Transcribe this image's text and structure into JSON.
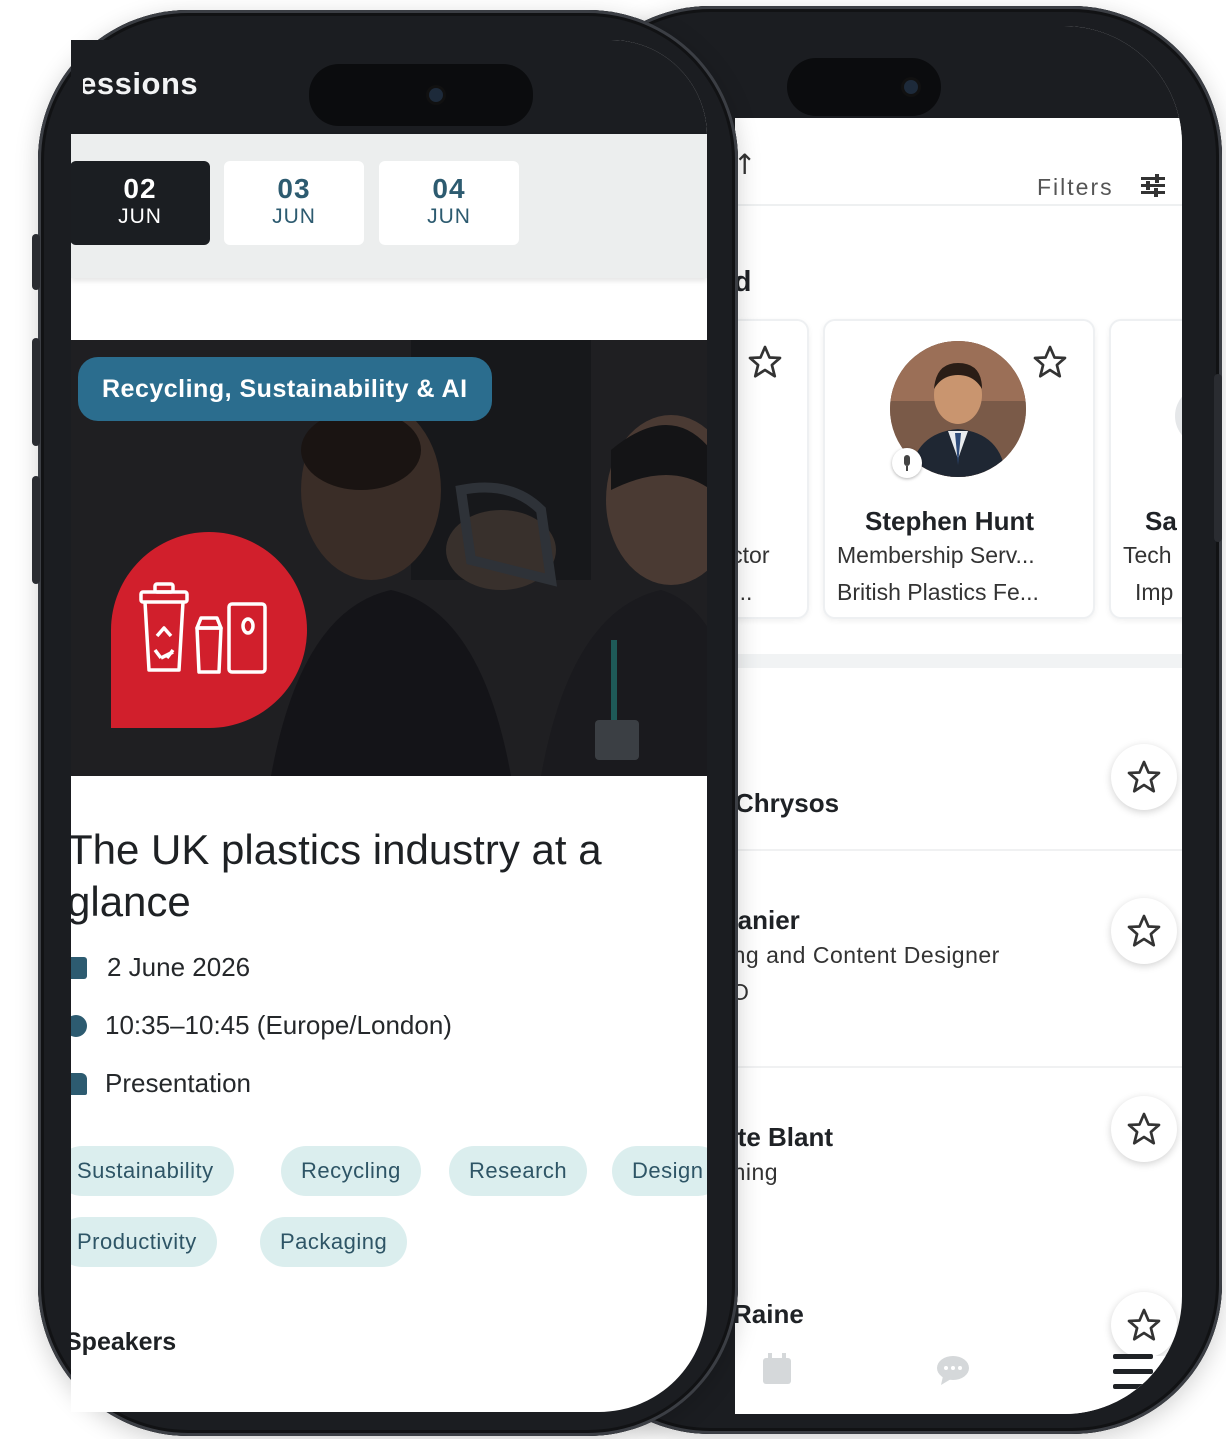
{
  "front": {
    "header_title": "Sessions",
    "dates": [
      {
        "day": "02",
        "month": "JUN",
        "active": true
      },
      {
        "day": "03",
        "month": "JUN",
        "active": false
      },
      {
        "day": "04",
        "month": "JUN",
        "active": false
      }
    ],
    "hero_tag": "Recycling, Sustainability & AI",
    "session_title": "The UK plastics industry at a glance",
    "date_text": "2 June 2026",
    "time_text": "10:35–10:45 (Europe/London)",
    "format_text": "Presentation",
    "tags": [
      "Sustainability",
      "Recycling",
      "Research",
      "Design",
      "Productivity",
      "Packaging"
    ],
    "speakers_heading": "Speakers"
  },
  "back": {
    "filters_label": "Filters",
    "featured_heading": "Featured",
    "featured_cards": [
      {
        "name": "",
        "role": "Director",
        "org": "Technol..."
      },
      {
        "name": "Stephen Hunt",
        "role": "Membership Serv...",
        "org": "British Plastics Fe..."
      },
      {
        "name": "Sa",
        "role": "Tech",
        "org": "Imp"
      }
    ],
    "list": [
      {
        "title": "Chrysos",
        "subtitle": ""
      },
      {
        "title": "tanier",
        "subtitle": "ing and Content Designer",
        "subtitle2": "O"
      },
      {
        "title": "tte Blant",
        "subtitle": "ining"
      },
      {
        "title": "Raine",
        "subtitle": ""
      }
    ]
  },
  "colors": {
    "accent": "#2b6d8e",
    "badge_red": "#d11f2c",
    "chip_bg": "#dbeeee",
    "dark": "#1b1e22"
  }
}
